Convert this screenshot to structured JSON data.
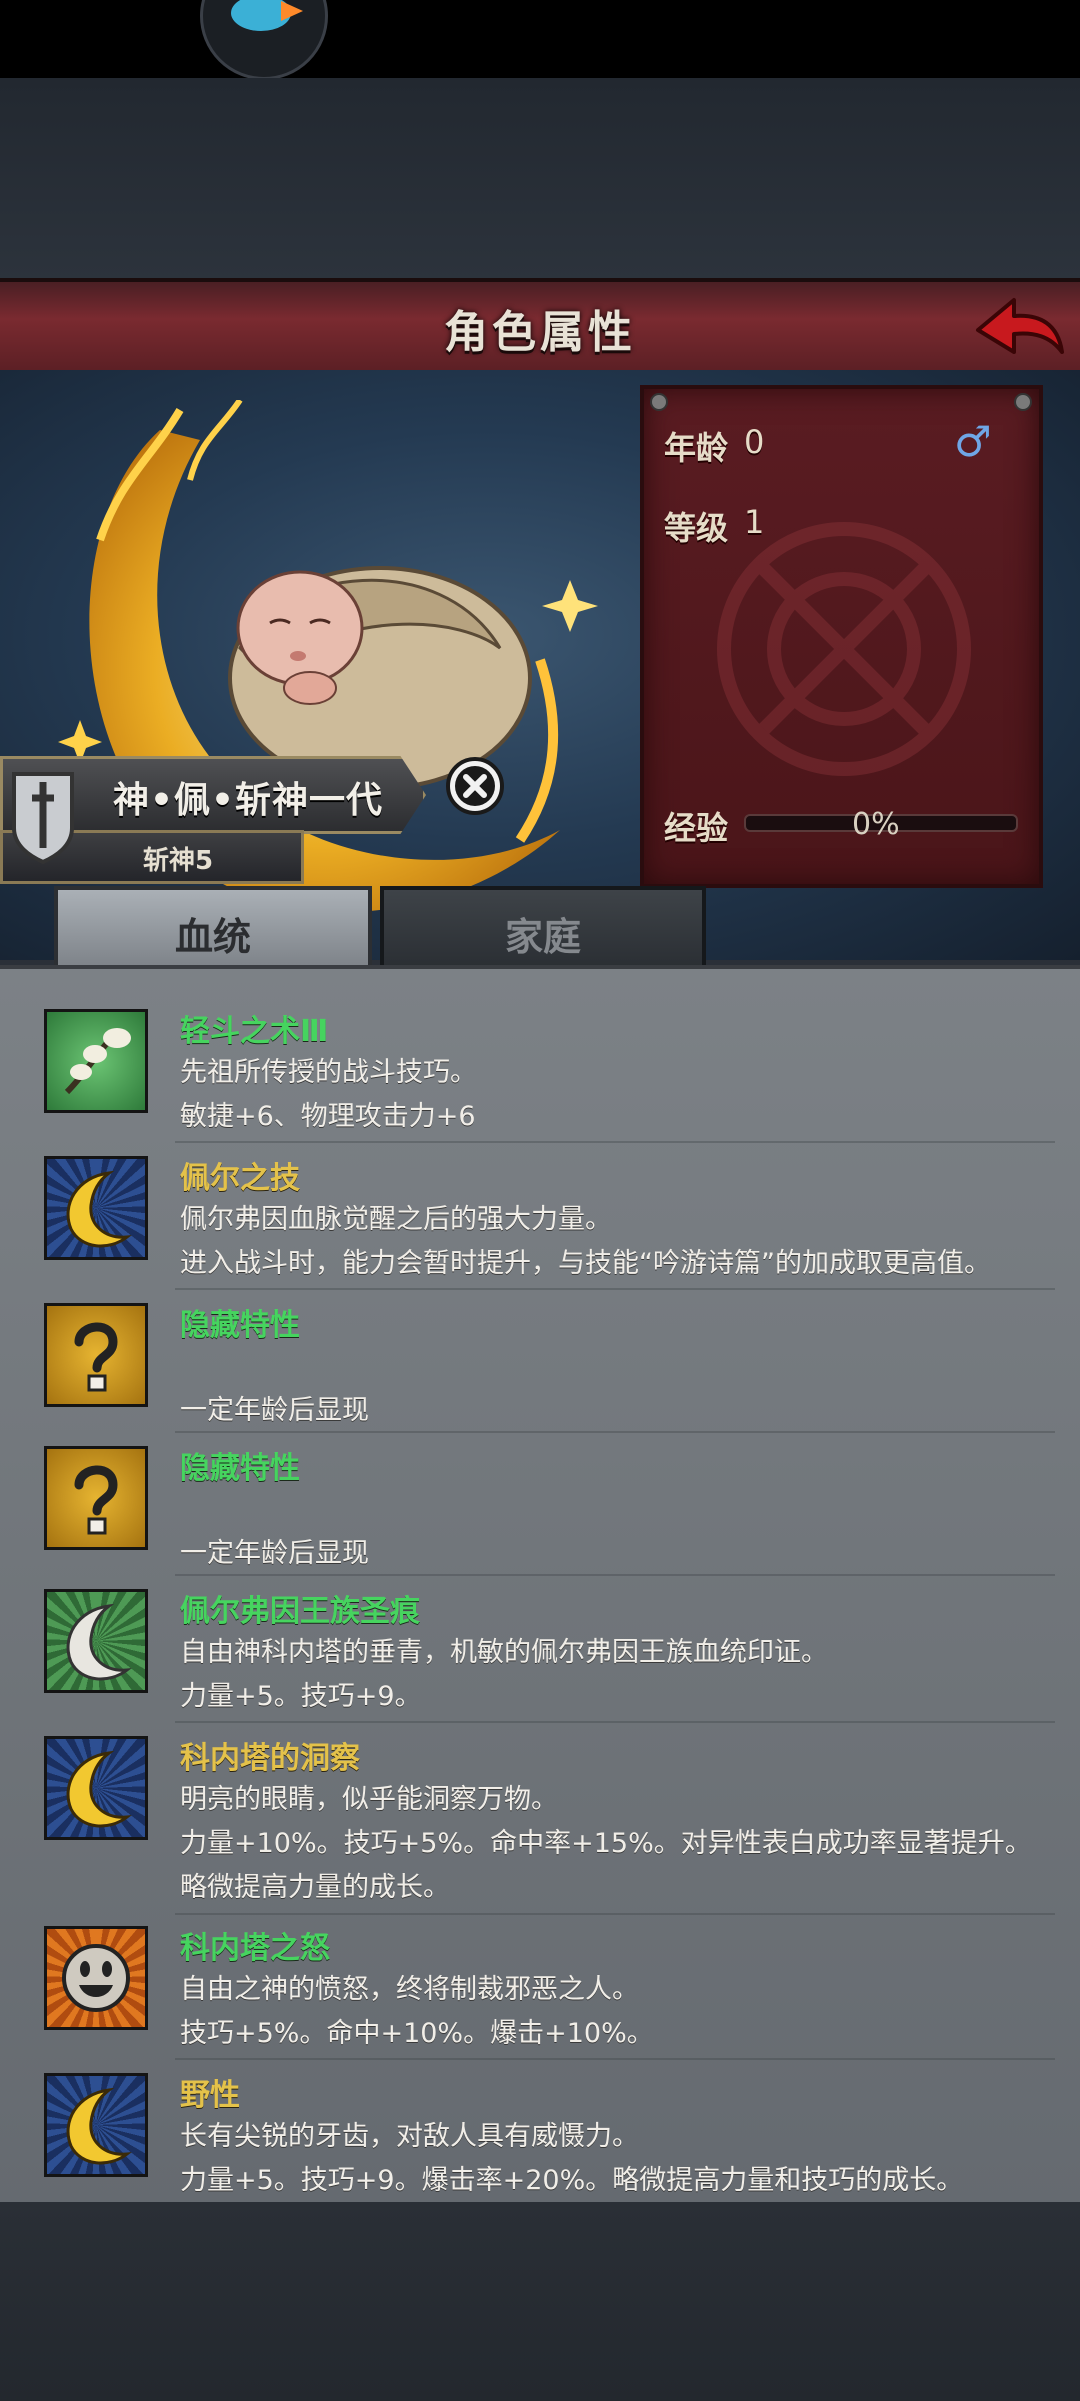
{
  "header": {
    "title": "角色属性"
  },
  "character": {
    "name": "神•佩•斩神一代",
    "subtitle": "斩神5",
    "age_label": "年龄",
    "age_value": "0",
    "level_label": "等级",
    "level_value": "1",
    "exp_label": "经验",
    "exp_value": "0%",
    "exp_fraction": 0,
    "gender": "male"
  },
  "tabs": [
    {
      "label": "血统",
      "active": true
    },
    {
      "label": "家庭",
      "active": false
    }
  ],
  "traits": [
    {
      "title": "轻斗之术Ⅲ",
      "title_color": "green",
      "icon": "twig-icon",
      "lines": [
        "先祖所传授的战斗技巧。",
        "敏捷+6、物理攻击力+6"
      ]
    },
    {
      "title": "佩尔之技",
      "title_color": "gold",
      "icon": "crescent-moon-icon",
      "lines": [
        "佩尔弗因血脉觉醒之后的强大力量。",
        "进入战斗时，能力会暂时提升，与技能“吟游诗篇”的加成取更高值。"
      ]
    },
    {
      "title": "隐藏特性",
      "title_color": "green",
      "icon": "question-mark-icon",
      "lines": [
        "",
        "一定年龄后显现"
      ]
    },
    {
      "title": "隐藏特性",
      "title_color": "green",
      "icon": "question-mark-icon",
      "lines": [
        "",
        "一定年龄后显现"
      ]
    },
    {
      "title": "佩尔弗因王族圣痕",
      "title_color": "green",
      "icon": "silver-crescent-icon",
      "lines": [
        "自由神科内塔的垂青，机敏的佩尔弗因王族血统印证。",
        "力量+5。技巧+9。"
      ]
    },
    {
      "title": "科内塔的洞察",
      "title_color": "gold",
      "icon": "crescent-moon-icon",
      "lines": [
        "明亮的眼睛，似乎能洞察万物。",
        "力量+10%。技巧+5%。命中率+15%。对异性表白成功率显著提升。",
        "略微提高力量的成长。"
      ]
    },
    {
      "title": "科内塔之怒",
      "title_color": "green",
      "icon": "smiley-face-icon",
      "lines": [
        "自由之神的愤怒，终将制裁邪恶之人。",
        "技巧+5%。命中+10%。爆击+10%。"
      ]
    },
    {
      "title": "野性",
      "title_color": "gold",
      "icon": "crescent-moon-icon",
      "lines": [
        "长有尖锐的牙齿，对敌人具有威慑力。",
        "力量+5。技巧+9。爆击率+20%。略微提高力量和技巧的成长。"
      ]
    }
  ]
}
